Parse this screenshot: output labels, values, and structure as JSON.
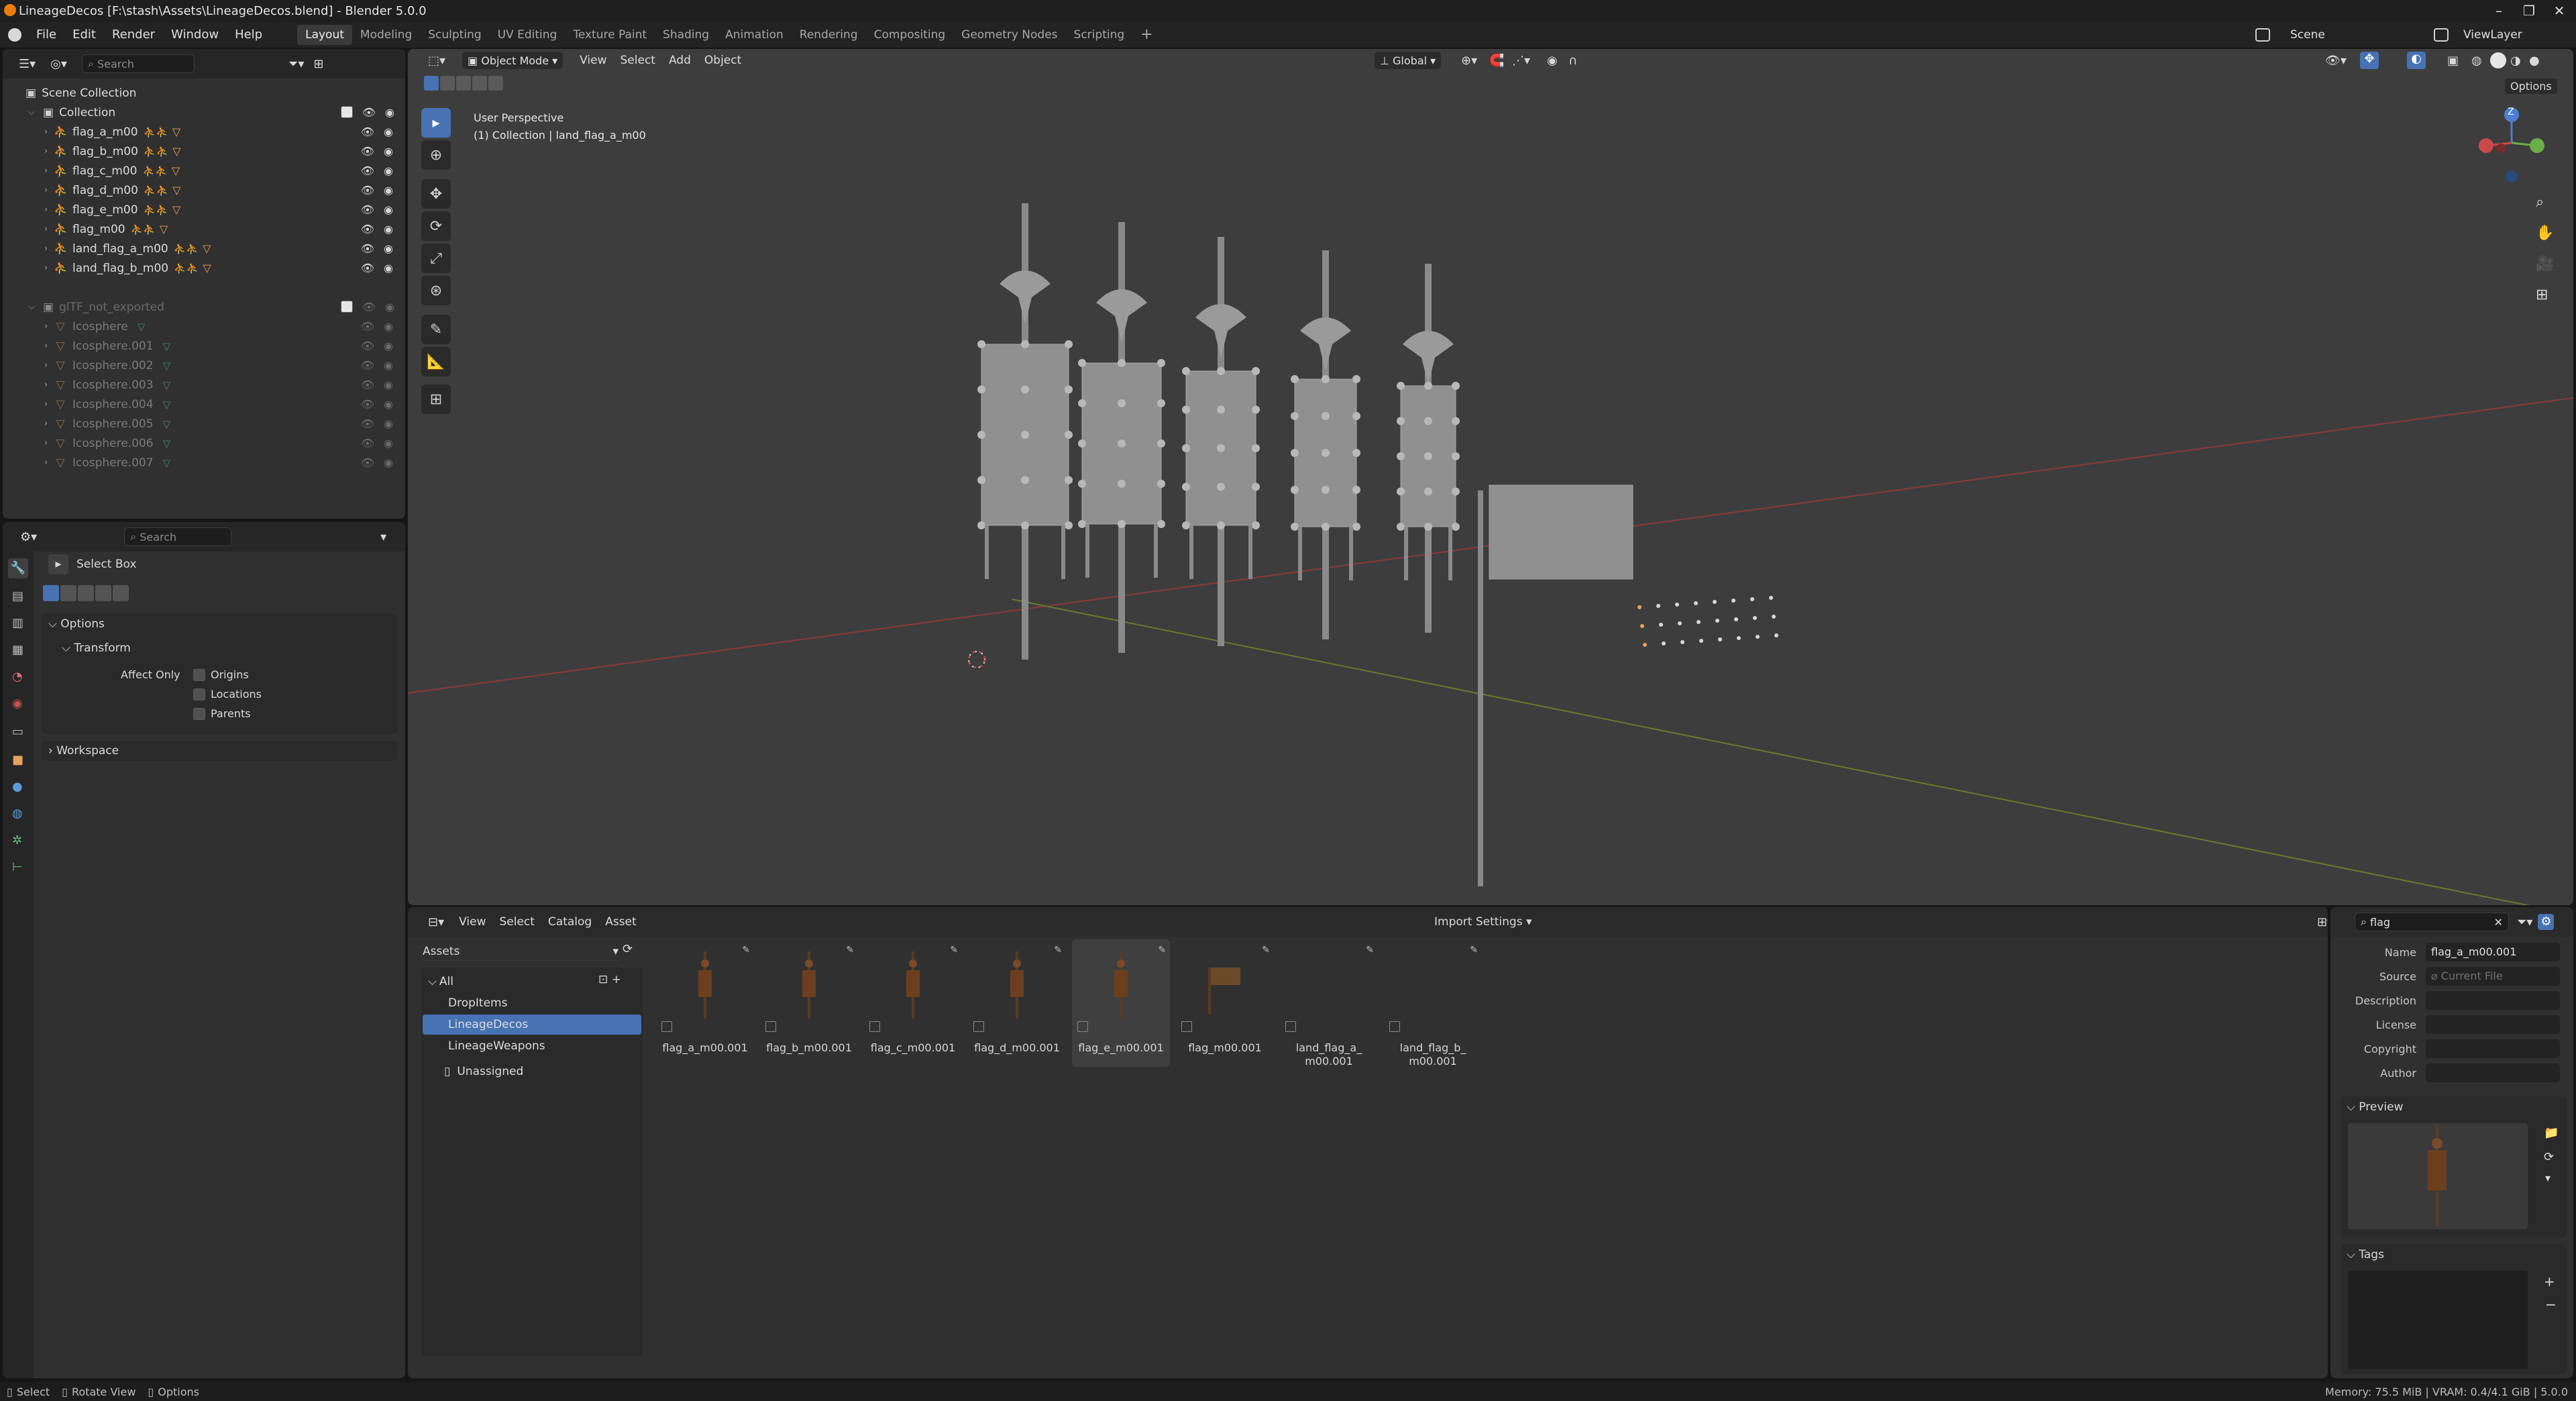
{
  "window": {
    "title": "LineageDecos [F:\\stash\\Assets\\LineageDecos.blend] - Blender 5.0.0",
    "controls": [
      "–",
      "❐",
      "✕"
    ]
  },
  "menus": [
    "File",
    "Edit",
    "Render",
    "Window",
    "Help"
  ],
  "workspaces": [
    "Layout",
    "Modeling",
    "Sculpting",
    "UV Editing",
    "Texture Paint",
    "Shading",
    "Animation",
    "Rendering",
    "Compositing",
    "Geometry Nodes",
    "Scripting"
  ],
  "workspace_add": "+",
  "scene": {
    "label": "Scene",
    "view_layer": "ViewLayer"
  },
  "outliner": {
    "search_placeholder": "Search",
    "root": "Scene Collection",
    "collection": "Collection",
    "items": [
      "flag_a_m00",
      "flag_b_m00",
      "flag_c_m00",
      "flag_d_m00",
      "flag_e_m00",
      "flag_m00",
      "land_flag_a_m00",
      "land_flag_b_m00"
    ],
    "collection2": "glTF_not_exported",
    "items2": [
      "Icosphere",
      "Icosphere.001",
      "Icosphere.002",
      "Icosphere.003",
      "Icosphere.004",
      "Icosphere.005",
      "Icosphere.006",
      "Icosphere.007"
    ]
  },
  "properties": {
    "search_placeholder": "Search",
    "tool_name": "Select Box",
    "options_label": "Options",
    "transform_label": "Transform",
    "affect_only": "Affect Only",
    "origins": "Origins",
    "locations": "Locations",
    "parents": "Parents",
    "workspace_label": "Workspace"
  },
  "viewport": {
    "mode": "Object Mode",
    "menus": [
      "View",
      "Select",
      "Add",
      "Object"
    ],
    "orientation": "Global",
    "options": "Options",
    "overlay_line1": "User Perspective",
    "overlay_line2": "(1) Collection | land_flag_a_m00",
    "gizmo_z": "Z"
  },
  "asset_browser": {
    "menus": [
      "View",
      "Select",
      "Catalog",
      "Asset"
    ],
    "import_settings": "Import Settings",
    "search_value": "flag",
    "library": "Assets",
    "catalog_all": "All",
    "catalogs": [
      "DropItems",
      "LineageDecos",
      "LineageWeapons"
    ],
    "unassigned": "Unassigned",
    "assets": [
      "flag_a_m00.001",
      "flag_b_m00.001",
      "flag_c_m00.001",
      "flag_d_m00.001",
      "flag_e_m00.001",
      "flag_m00.001",
      "land_flag_a_\nm00.001",
      "land_flag_b_\nm00.001"
    ]
  },
  "asset_details": {
    "name_label": "Name",
    "name_value": "flag_a_m00.001",
    "source_label": "Source",
    "source_value": "Current File",
    "description_label": "Description",
    "license_label": "License",
    "copyright_label": "Copyright",
    "author_label": "Author",
    "preview_label": "Preview",
    "tags_label": "Tags"
  },
  "status": {
    "select": "Select",
    "rotate": "Rotate View",
    "options": "Options",
    "memory": "Memory: 75.5 MiB | VRAM: 0.4/4.1 GiB | 5.0.0"
  },
  "colors": {
    "accent": "#4772b3",
    "object_orange": "#e6a15a",
    "modifier_teal": "#6ec1c8",
    "viewport_bg": "#3d3d3d"
  }
}
